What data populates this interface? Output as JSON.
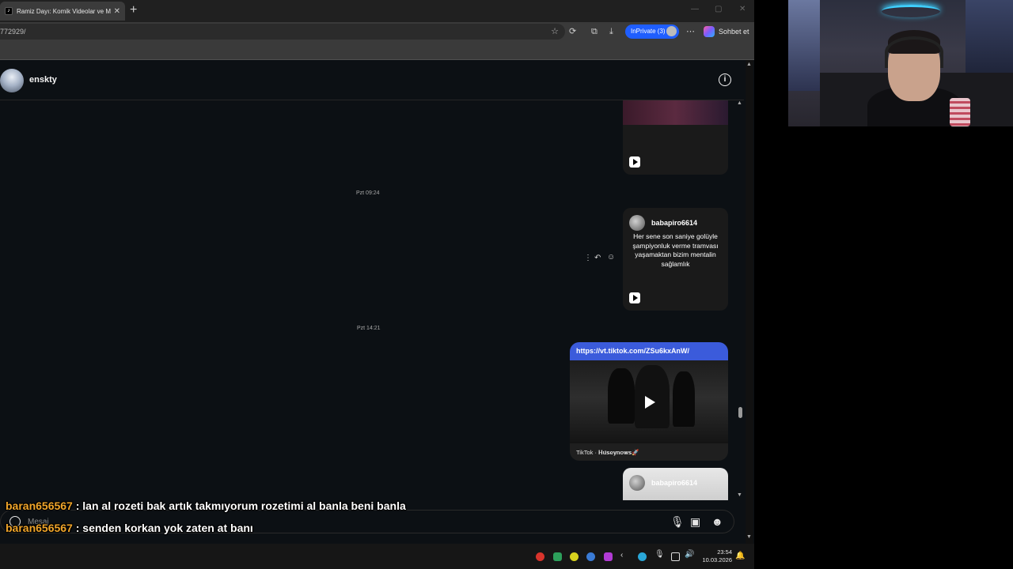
{
  "browser": {
    "tab_title": "Ramiz Dayı: Komik Videolar ve Mo",
    "tab_favicon": "tiktok-icon",
    "close_tab": "✕",
    "new_tab": "+",
    "url": "772929/",
    "inprivate_label": "InPrivate (3)",
    "copilot_label": "Sohbet et",
    "window_controls": [
      "—",
      "▢",
      "✕"
    ]
  },
  "chat": {
    "username": "enskty",
    "info_icon": "i",
    "timestamps": [
      "Pzt 09:24",
      "Pzt 14:21"
    ],
    "post_card": {
      "user": "babapiro6614",
      "caption": "Her sene son saniye golüyle şampiyonluk verme tramvası yaşamaktan bizim mentalin sağlamlık"
    },
    "link_message": {
      "url": "https://vt.tiktok.com/ZSu6kxAnW/",
      "caption": "TikTok · 𝐇𝐮̈𝐬𝐞𝐲𝐧𝐨𝐰𝐬🚀"
    },
    "bottom_card_user": "babapiro6614",
    "input_placeholder": "Mesaj"
  },
  "stream_chat": [
    {
      "user": "baran656567",
      "message": " : lan al rozeti bak artık takmıyorum rozetimi al banla beni banla"
    },
    {
      "user": "baran656567",
      "message": " : senden korkan yok zaten at banı"
    }
  ],
  "taskbar": {
    "time": "23:54",
    "date": "10.03.2026"
  },
  "colors": {
    "accent_blue": "#1f5eff",
    "link_header": "#3b5bdb",
    "chat_username": "#f0a52a",
    "background": "#0c1014"
  }
}
